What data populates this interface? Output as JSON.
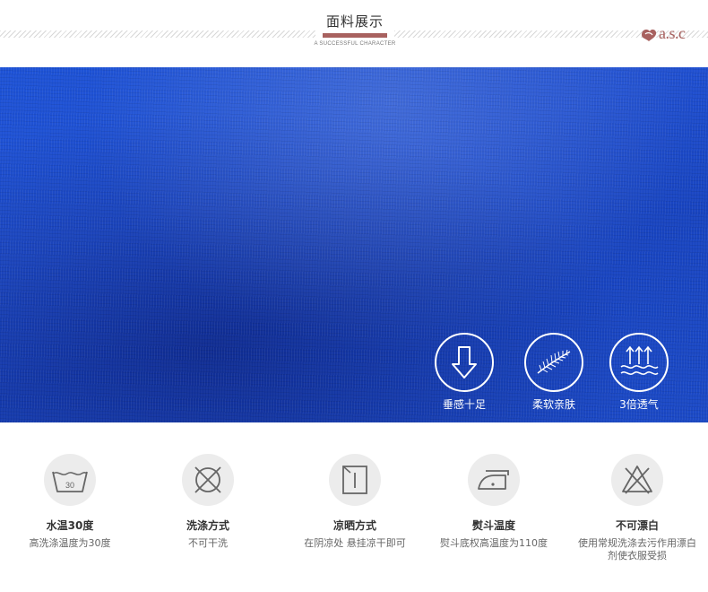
{
  "header": {
    "title": "面料展示",
    "subtitle": "A SUCCESSFUL CHARACTER",
    "logo_text": "a.s.c"
  },
  "colors": {
    "accent": "#a8615f",
    "fabric_blue": "#1d4fcf"
  },
  "features": [
    {
      "label": "垂感十足",
      "icon": "down-arrow-icon"
    },
    {
      "label": "柔软亲肤",
      "icon": "feather-icon"
    },
    {
      "label": "3倍透气",
      "icon": "breathable-waves-icon"
    }
  ],
  "care": [
    {
      "title": "水温30度",
      "desc": "高洗涤温度为30度",
      "icon": "wash-30-icon",
      "icon_text": "30"
    },
    {
      "title": "洗涤方式",
      "desc": "不可干洗",
      "icon": "no-dry-clean-icon"
    },
    {
      "title": "凉晒方式",
      "desc": "在阴凉处 悬挂凉干即可",
      "icon": "line-dry-shade-icon"
    },
    {
      "title": "熨斗温度",
      "desc": "熨斗底权高温度为110度",
      "icon": "iron-icon"
    },
    {
      "title": "不可漂白",
      "desc": "使用常规洗涤去污作用漂白剂使衣服受损",
      "icon": "no-bleach-icon"
    }
  ]
}
